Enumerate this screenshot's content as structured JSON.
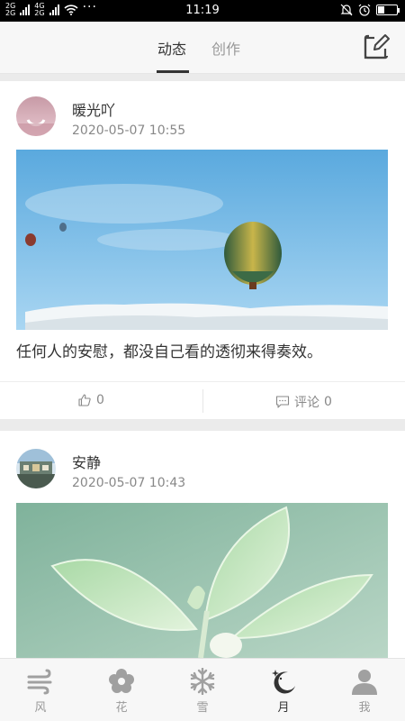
{
  "status_bar": {
    "network_top": "4G",
    "network_bottom": "2G",
    "sim_top": "2G",
    "sim_bottom": "2G",
    "dots": "···",
    "time": "11:19"
  },
  "header": {
    "tabs": [
      {
        "label": "动态",
        "active": true
      },
      {
        "label": "创作",
        "active": false
      }
    ],
    "edit_icon": "edit-icon"
  },
  "posts": [
    {
      "author": "暖光吖",
      "time": "2020-05-07 10:55",
      "caption": "任何人的安慰，都没自己看的透彻来得奏效。",
      "likes": "0",
      "comment_label": "评论",
      "comments": "0",
      "photo": "hot-air-balloons-photo"
    },
    {
      "author": "安静",
      "time": "2020-05-07 10:43",
      "photo": "green-leaves-photo"
    }
  ],
  "bottom_nav": {
    "items": [
      {
        "label": "风",
        "icon": "wind-icon",
        "active": false
      },
      {
        "label": "花",
        "icon": "flower-icon",
        "active": false
      },
      {
        "label": "雪",
        "icon": "snowflake-icon",
        "active": false
      },
      {
        "label": "月",
        "icon": "moon-icon",
        "active": true
      },
      {
        "label": "我",
        "icon": "user-icon",
        "active": false
      }
    ]
  },
  "colors": {
    "accent": "#333333",
    "inactive": "#999999",
    "background": "#f2f2f2"
  }
}
